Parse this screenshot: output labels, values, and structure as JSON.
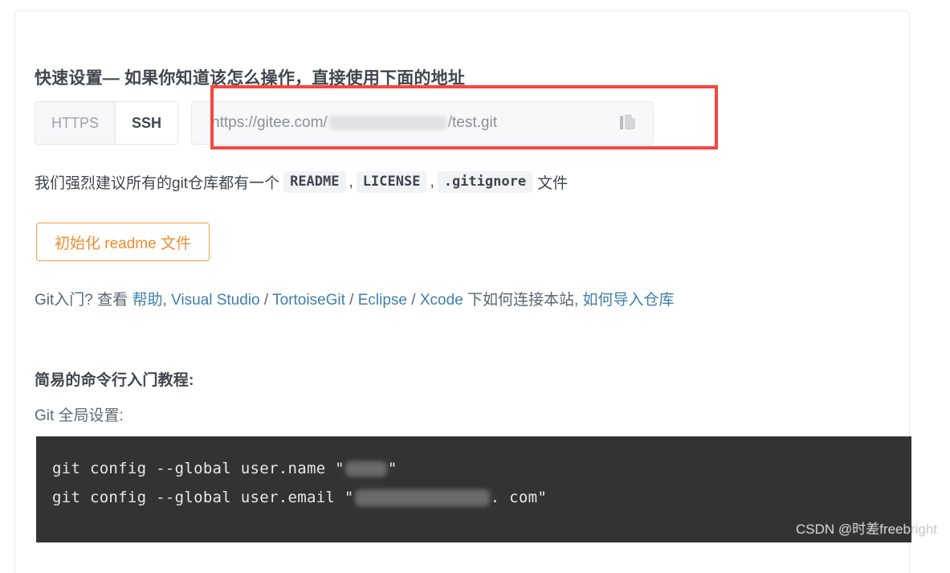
{
  "card": {
    "quick_setup_heading": "快速设置— 如果你知道该怎么操作，直接使用下面的地址",
    "cli_tutorial_heading": "简易的命令行入门教程:"
  },
  "clone": {
    "protocols": [
      {
        "label": "HTTPS",
        "active": false
      },
      {
        "label": "SSH",
        "active": true
      }
    ],
    "url_prefix": "https://gitee.com/",
    "url_suffix": "/test.git",
    "url_full": "https://gitee.com/██████/test.git",
    "url_redacted": true,
    "copy_icon": "copy-icon",
    "highlight_color": "#f7463f"
  },
  "recommend": {
    "prefix": "我们强烈建议所有的git仓库都有一个",
    "chips": [
      "README",
      "LICENSE",
      ".gitignore"
    ],
    "separator": ",",
    "suffix": "文件"
  },
  "init_readme": {
    "label": "初始化 readme 文件",
    "accent_color": "#f08c2e"
  },
  "git_intro": {
    "lead": "Git入门?",
    "view_label": "查看",
    "help_link": "帮助",
    "comma": ",",
    "tools": [
      "Visual Studio",
      "TortoiseGit",
      "Eclipse",
      "Xcode"
    ],
    "tool_separator": "/",
    "mid_text": "下如何连接本站,",
    "import_link": "如何导入仓库",
    "link_color": "#3f7fab"
  },
  "global_config": {
    "label": "Git 全局设置:",
    "lines": [
      {
        "prefix": "git config --global user.name \"",
        "redacted": "name",
        "suffix": "\""
      },
      {
        "prefix": "git config --global user.email \"",
        "redacted": "email",
        "suffix": ". com\""
      }
    ],
    "background_color": "#333333",
    "text_color": "#e8e8e8"
  },
  "watermark": {
    "text": "CSDN @时差freebright"
  }
}
